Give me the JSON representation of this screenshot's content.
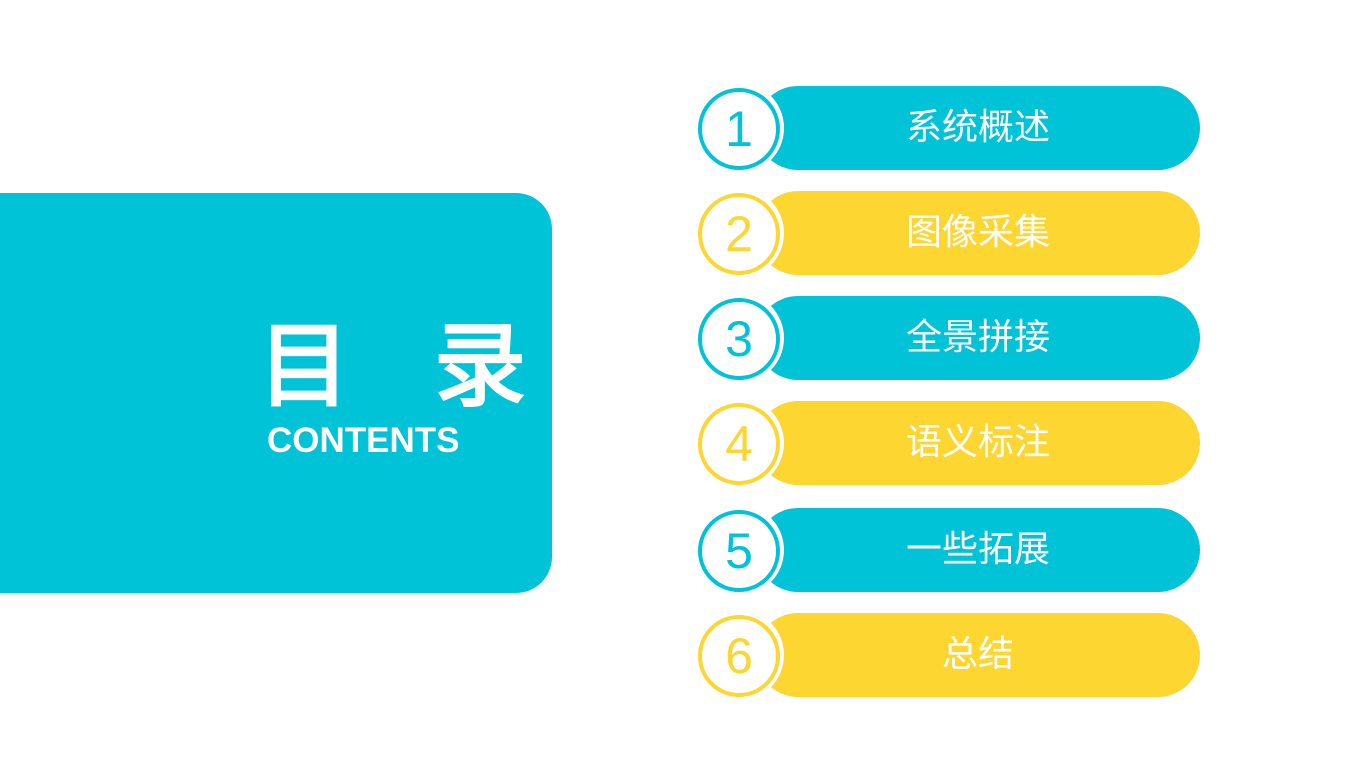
{
  "title": {
    "main": "目 录",
    "sub": "CONTENTS"
  },
  "colors": {
    "cyan": "#00c3d8",
    "yellow": "#fdd632",
    "background": "#ffffff",
    "text": "#ffffff"
  },
  "items": [
    {
      "number": "1",
      "label": "系统概述",
      "color": "#00c3d8"
    },
    {
      "number": "2",
      "label": "图像采集",
      "color": "#fdd632"
    },
    {
      "number": "3",
      "label": "全景拼接",
      "color": "#00c3d8"
    },
    {
      "number": "4",
      "label": "语义标注",
      "color": "#fdd632"
    },
    {
      "number": "5",
      "label": "一些拓展",
      "color": "#00c3d8"
    },
    {
      "number": "6",
      "label": "总结",
      "color": "#fdd632"
    }
  ]
}
